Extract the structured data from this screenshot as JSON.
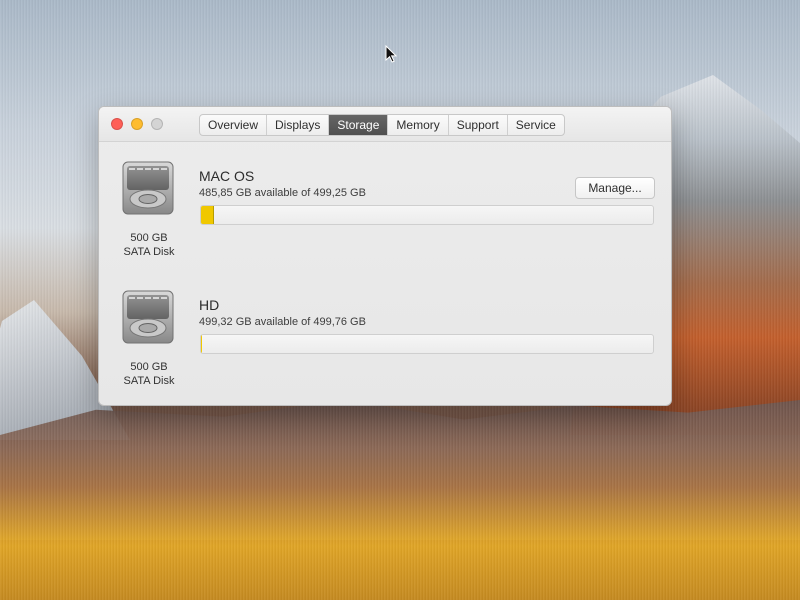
{
  "tabs": [
    {
      "label": "Overview"
    },
    {
      "label": "Displays"
    },
    {
      "label": "Storage"
    },
    {
      "label": "Memory"
    },
    {
      "label": "Support"
    },
    {
      "label": "Service"
    }
  ],
  "active_tab": "Storage",
  "disks": [
    {
      "volume_name": "MAC OS",
      "availability_text": "485,85 GB available of 499,25 GB",
      "disk_size": "500 GB",
      "disk_type": "SATA Disk",
      "used_fraction": 0.027,
      "bar_color": "#f0c800",
      "manage_label": "Manage..."
    },
    {
      "volume_name": "HD",
      "availability_text": "499,32 GB available of 499,76 GB",
      "disk_size": "500 GB",
      "disk_type": "SATA Disk",
      "used_fraction": 0.001,
      "bar_color": "#f0c800"
    }
  ],
  "icons": {
    "close": "close-window-icon",
    "minimize": "minimize-window-icon",
    "zoom": "zoom-window-icon",
    "disk": "hard-disk-icon",
    "cursor": "mouse-pointer-icon"
  },
  "colors": {
    "window_bg": "#e7e7e7",
    "active_tab_bg": "#555555",
    "close": "#ff5f57",
    "minimize": "#febc2e",
    "zoom_inactive": "#d4d4d4"
  }
}
